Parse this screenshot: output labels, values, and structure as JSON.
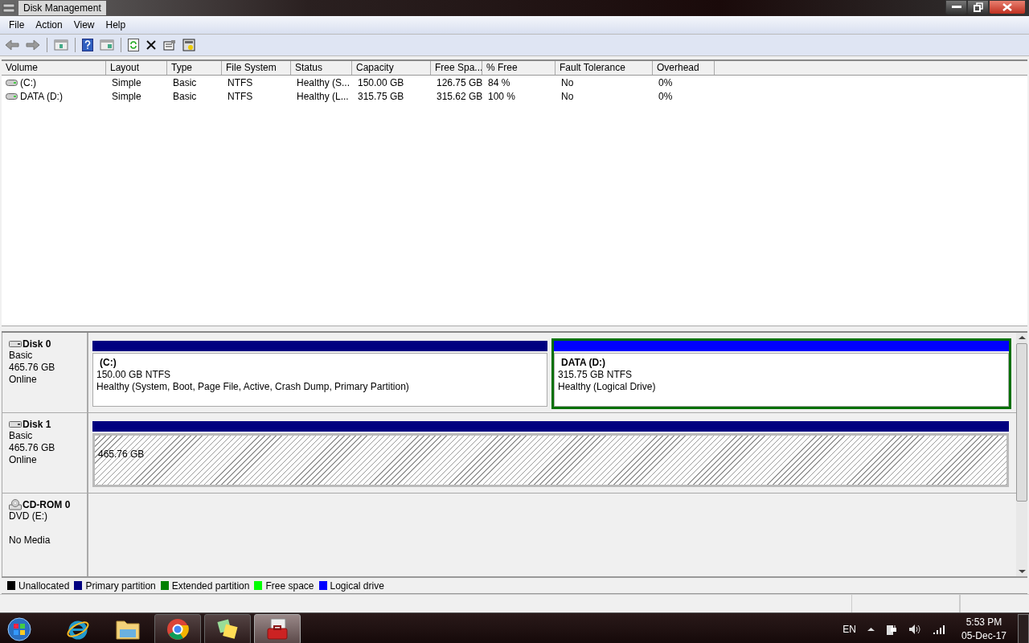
{
  "window": {
    "title": "Disk Management"
  },
  "menu": [
    "File",
    "Action",
    "View",
    "Help"
  ],
  "table": {
    "columns": [
      "Volume",
      "Layout",
      "Type",
      "File System",
      "Status",
      "Capacity",
      "Free Spa...",
      "% Free",
      "Fault Tolerance",
      "Overhead"
    ],
    "rows": [
      {
        "cells": [
          "(C:)",
          "Simple",
          "Basic",
          "NTFS",
          "Healthy (S...",
          "150.00 GB",
          "126.75 GB",
          "84 %",
          "No",
          "0%"
        ]
      },
      {
        "cells": [
          "DATA (D:)",
          "Simple",
          "Basic",
          "NTFS",
          "Healthy (L...",
          "315.75 GB",
          "315.62 GB",
          "100 %",
          "No",
          "0%"
        ]
      }
    ]
  },
  "disks": [
    {
      "kind": "disk",
      "name": "Disk 0",
      "lines": [
        "Basic",
        "465.76 GB",
        "Online"
      ],
      "partitions": [
        {
          "kind": "volume",
          "color": "#000080",
          "selected": false,
          "title": "(C:)",
          "size": "150.00 GB NTFS",
          "status": "Healthy (System, Boot, Page File, Active, Crash Dump, Primary Partition)"
        },
        {
          "kind": "volume",
          "color": "#0000ff",
          "selected": true,
          "title": "DATA  (D:)",
          "size": "315.75 GB NTFS",
          "status": "Healthy (Logical Drive)"
        }
      ]
    },
    {
      "kind": "disk",
      "name": "Disk 1",
      "lines": [
        "Basic",
        "465.76 GB",
        "Online"
      ],
      "partitions": [
        {
          "kind": "unallocated",
          "color": "#000080",
          "selected": false,
          "size": "465.76 GB"
        }
      ]
    },
    {
      "kind": "cdrom",
      "name": "CD-ROM 0",
      "lines": [
        "DVD (E:)",
        "No Media"
      ]
    }
  ],
  "legend": [
    {
      "color": "#000000",
      "label": "Unallocated"
    },
    {
      "color": "#000080",
      "label": "Primary partition"
    },
    {
      "color": "#008000",
      "label": "Extended partition"
    },
    {
      "color": "#00ff00",
      "label": "Free space"
    },
    {
      "color": "#0000ff",
      "label": "Logical drive"
    }
  ],
  "taskbar": {
    "apps": [
      {
        "kind": "ie",
        "running": false,
        "selected": false
      },
      {
        "kind": "folder",
        "running": false,
        "selected": false
      },
      {
        "kind": "chrome",
        "running": true,
        "selected": false
      },
      {
        "kind": "notes",
        "running": true,
        "selected": false
      },
      {
        "kind": "toolbox",
        "running": true,
        "selected": true
      }
    ],
    "language": "EN",
    "time": "5:53 PM",
    "date": "05-Dec-17"
  }
}
